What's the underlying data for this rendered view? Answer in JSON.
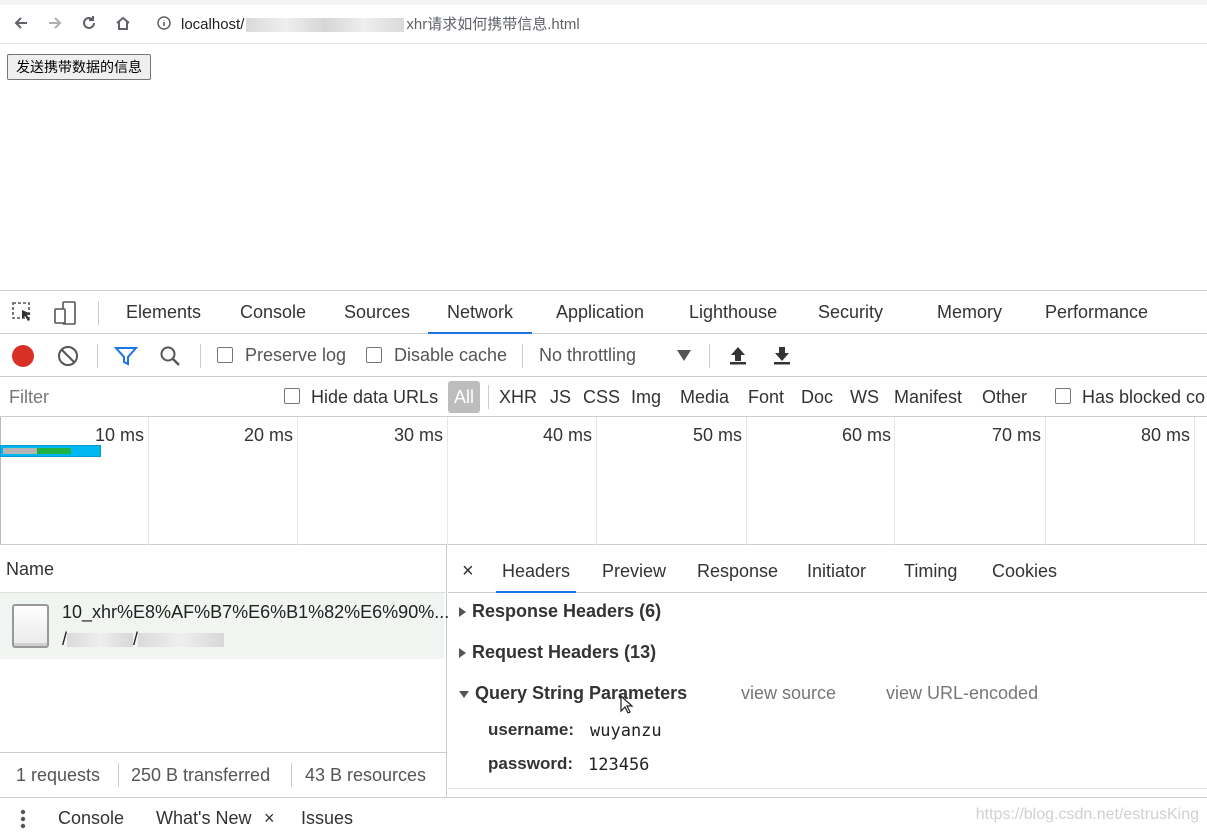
{
  "browser": {
    "url_host": "localhost/",
    "url_file": "xhr请求如何携带信息.html"
  },
  "page": {
    "button_label": "发送携带数据的信息"
  },
  "devtools": {
    "tabs": [
      "Elements",
      "Console",
      "Sources",
      "Network",
      "Application",
      "Lighthouse",
      "Security",
      "Memory",
      "Performance"
    ],
    "active_tab": "Network",
    "toolbar": {
      "preserve_log": "Preserve log",
      "disable_cache": "Disable cache",
      "throttling": "No throttling"
    },
    "filterbar": {
      "filter_placeholder": "Filter",
      "hide_data_urls": "Hide data URLs",
      "types": [
        "All",
        "XHR",
        "JS",
        "CSS",
        "Img",
        "Media",
        "Font",
        "Doc",
        "WS",
        "Manifest",
        "Other"
      ],
      "has_blocked": "Has blocked co"
    },
    "timeline": {
      "ticks": [
        "10 ms",
        "20 ms",
        "30 ms",
        "40 ms",
        "50 ms",
        "60 ms",
        "70 ms",
        "80 ms"
      ]
    },
    "requests": {
      "column_name": "Name",
      "items": [
        {
          "name": "10_xhr%E8%AF%B7%E6%B1%82%E6%90%...",
          "path_sep": "/"
        }
      ]
    },
    "summary": {
      "requests": "1 requests",
      "transferred": "250 B transferred",
      "resources": "43 B resources"
    },
    "detail": {
      "close": "×",
      "tabs": [
        "Headers",
        "Preview",
        "Response",
        "Initiator",
        "Timing",
        "Cookies"
      ],
      "active_tab": "Headers",
      "response_headers": "Response Headers (6)",
      "request_headers": "Request Headers (13)",
      "query_string": "Query String Parameters",
      "view_source": "view source",
      "view_url_encoded": "view URL-encoded",
      "params": [
        {
          "key": "username:",
          "value": "wuyanzu"
        },
        {
          "key": "password:",
          "value": "123456"
        }
      ]
    },
    "drawer": {
      "console": "Console",
      "whats_new": "What's New",
      "close": "×",
      "issues": "Issues"
    },
    "watermark": "https://blog.csdn.net/estrusKing"
  },
  "colors": {
    "accent": "#1a73e8",
    "record": "#d93025",
    "filter_icon": "#1a73e8"
  }
}
